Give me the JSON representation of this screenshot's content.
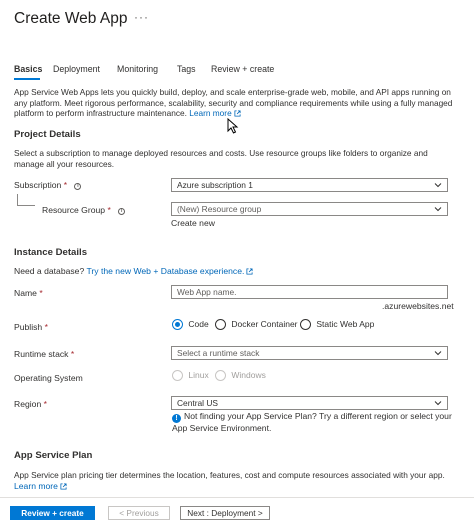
{
  "header": {
    "title": "Create Web App",
    "more": "···"
  },
  "tabs": [
    {
      "label": "Basics",
      "active": true
    },
    {
      "label": "Deployment",
      "active": false
    },
    {
      "label": "Monitoring",
      "active": false
    },
    {
      "label": "Tags",
      "active": false
    },
    {
      "label": "Review + create",
      "active": false
    }
  ],
  "intro": {
    "text": "App Service Web Apps lets you quickly build, deploy, and scale enterprise-grade web, mobile, and API apps running on any platform. Meet rigorous performance, scalability, security and compliance requirements while using a fully managed platform to perform infrastructure maintenance.",
    "link": "Learn more"
  },
  "project": {
    "heading": "Project Details",
    "desc": "Select a subscription to manage deployed resources and costs. Use resource groups like folders to organize and manage all your resources.",
    "subscription": {
      "label": "Subscription",
      "req": "*",
      "value": "Azure subscription 1"
    },
    "resource_group": {
      "label": "Resource Group",
      "req": "*",
      "value": "(New) Resource group",
      "create_new": "Create new"
    }
  },
  "instance": {
    "heading": "Instance Details",
    "database_text": "Need a database?",
    "database_link": "Try the new Web + Database experience.",
    "name": {
      "label": "Name",
      "req": "*",
      "placeholder": "Web App name.",
      "suffix": ".azurewebsites.net"
    },
    "publish": {
      "label": "Publish",
      "req": "*",
      "options": [
        "Code",
        "Docker Container",
        "Static Web App"
      ],
      "selected": "Code"
    },
    "runtime": {
      "label": "Runtime stack",
      "req": "*",
      "placeholder": "Select a runtime stack"
    },
    "os": {
      "label": "Operating System",
      "options": [
        "Linux",
        "Windows"
      ]
    },
    "region": {
      "label": "Region",
      "req": "*",
      "value": "Central US",
      "notice_line1": "Not finding your App Service Plan? Try a different region or select your",
      "notice_line2": "App Service Environment."
    }
  },
  "plan": {
    "heading": "App Service Plan",
    "desc": "App Service plan pricing tier determines the location, features, cost and compute resources associated with your app.",
    "link": "Learn more"
  },
  "footer": {
    "review_create": "Review + create",
    "previous": "< Previous",
    "next": "Next : Deployment >"
  },
  "colors": {
    "accent": "#0078d4",
    "link": "#0067b8",
    "required": "#a4262c"
  }
}
